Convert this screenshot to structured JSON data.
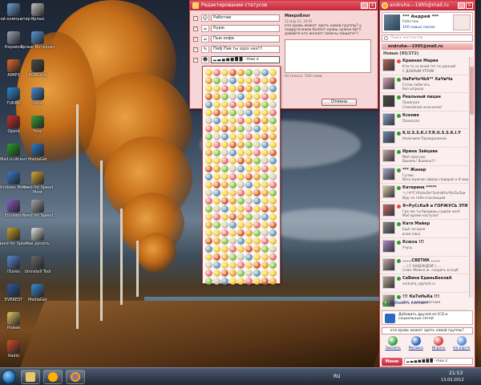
{
  "desktop": {
    "icons": [
      {
        "label": "Мой компьютер",
        "color": "#6aa0d8"
      },
      {
        "label": "Корзина",
        "color": "#9aa8b8"
      },
      {
        "label": "AIMP3",
        "color": "#e86a2a"
      },
      {
        "label": "TURBO",
        "color": "#2a8ad8"
      },
      {
        "label": "Opera",
        "color": "#d02a2a"
      },
      {
        "label": "Mail.ru Агент",
        "color": "#2aa02a"
      },
      {
        "label": "Windows Media",
        "color": "#3a78c8"
      },
      {
        "label": "Emulator",
        "color": "#8a5ac8"
      },
      {
        "label": "Need for Speed",
        "color": "#c8a02a"
      },
      {
        "label": "iTunes",
        "color": "#5a8ad8"
      },
      {
        "label": "EVEREST",
        "color": "#2a5aa8"
      },
      {
        "label": "Новые",
        "color": "#e8c86a"
      },
      {
        "label": "Radio",
        "color": "#d84a2a"
      }
    ],
    "icons_col2": [
      {
        "label": "Ярлык",
        "color": "#c8c8c8"
      },
      {
        "label": "Ярлык Интернет",
        "color": "#5a9ad8"
      },
      {
        "label": "KGBtools",
        "color": "#4a4a4a"
      },
      {
        "label": "Сеть",
        "color": "#4a8ad8"
      },
      {
        "label": "Total",
        "color": "#3aa03a"
      },
      {
        "label": "MediaGet",
        "color": "#2a7ac8"
      },
      {
        "label": "Need for Speed Most",
        "color": "#d8a83a"
      },
      {
        "label": "Need for Speed",
        "color": "#a8a8a8"
      },
      {
        "label": "Как делать",
        "color": "#e8e8e8"
      },
      {
        "label": "Uninstall Tool",
        "color": "#6a6a6a"
      },
      {
        "label": "MediaGet",
        "color": "#3a8ad8"
      }
    ]
  },
  "taskbar": {
    "lang": "RU",
    "time": "21:53",
    "date": "13.03.2012"
  },
  "status_window": {
    "title": "Редактирование статусов",
    "statuses": [
      {
        "icon": "☺",
        "text": "Работаю"
      },
      {
        "icon": "☕",
        "text": "Курю"
      },
      {
        "icon": "☕",
        "text": "Пью кофе"
      },
      {
        "icon": "✎",
        "text": "Пиф Пав ты здох нах!!!"
      },
      {
        "icon": "☻",
        "text": "▂ ▃ ▄ ▅ ▆ ▇ █ - max z"
      }
    ],
    "detail": {
      "title": "Микроблог",
      "date": "12 мар 12, 19:01",
      "text": "кто кровь может здать новой группы? у подруги мама болеет кровь нужна 4й!!! давайте кто желает помочь пишите!!!",
      "remaining": "Осталось: 500 симв."
    },
    "cancel_label": "Отмена"
  },
  "emoji_colors": [
    "#f2c94c",
    "#e8a03a",
    "#f4d24a",
    "#d85a3a",
    "#5a9ad8",
    "#f2c94c",
    "#c8c8c8",
    "#e86a8a",
    "#7ac85a"
  ],
  "agent": {
    "title": "andruha---1995@mail.ru",
    "user_name": "*** Андрей ***",
    "user_status": "Работаю",
    "user_mail": "100 новых писем",
    "search_placeholder": "Поиск контактов",
    "account": "andruha---1995@mail.ru",
    "group": "Новые (95/372)",
    "contacts": [
      {
        "name": "Кравная Мария",
        "status": "Кто-то со мной тот по данной",
        "status2": "С ДОБРЫМ УТРОМ",
        "dot": "#e84a4a",
        "avatar": "#b06a5a"
      },
      {
        "name": "НаРиЧоЧkA** ХаЧиЧа",
        "status": "Готов побегать",
        "status2": "Без шприца",
        "dot": "#2aa02a",
        "avatar": "#d8a8b8"
      },
      {
        "name": "Реальный пацан",
        "status": "Проиграл",
        "status2": "Спокойной ночи всем!",
        "dot": "#2aa02a",
        "avatar": "#4a4a4a"
      },
      {
        "name": "Ксения",
        "status": "Проиграл",
        "status2": "",
        "dot": "#2aa02a",
        "avatar": "#8aa0c8"
      },
      {
        "name": "K.U.S.S.K.I.Y.R.U.S.S.K.I.Y",
        "status": "Наличием Пражданином",
        "status2": "",
        "dot": "#2aa02a",
        "avatar": "#6a8ab0"
      },
      {
        "name": "Ирина Зайцева",
        "status": "Моё прессую",
        "status2": "Выкинь! Выкинь!!!",
        "dot": "#2aa02a",
        "avatar": "#c8a8a8"
      },
      {
        "name": "*** Жанар",
        "status": "Гуляю",
        "status2": "Всех мужчин айдаш подарок к 8 мар",
        "dot": "#2aa02a",
        "avatar": "#a8a8c8"
      },
      {
        "name": "Катерина *****",
        "status": "*=*#*СтРаНнОе*ЗнАчИтЬ*КоЛьЛаи",
        "status2": "Иду на тебя спасающий",
        "dot": "#2aa02a",
        "avatar": "#d8c8a8"
      },
      {
        "name": "Я=РуСсКаЯ и ГОРЖУСЬ ЭТИМ",
        "status": "Где же ты бродишь,судьба моя?",
        "status2": "Моё время наступит",
        "dot": "#e84a4a",
        "avatar": "#c86a6a"
      },
      {
        "name": "Катя Майер",
        "status": "Ещё сегодня",
        "status2": "всем пока",
        "dot": "#2aa02a",
        "avatar": "#8a8a8a"
      },
      {
        "name": "Ксюха !!!",
        "status": "Учусь",
        "status2": "",
        "dot": "#2aa02a",
        "avatar": "#a88ac8"
      },
      {
        "name": "......СВЕТИК ......",
        "status": "....( С НАДЕЖДОЙ ).....",
        "status2": "Снов. Можно ж. сходить в клуб",
        "dot": "#2aa02a",
        "avatar": "#c8a8a8"
      },
      {
        "name": "СаВина ЕдиньБековА",
        "status": "andruha_x@mail.ru",
        "status2": "",
        "dot": "#2aa02a",
        "avatar": "#b8a898"
      },
      {
        "name": "!!! КаТеНьКа !!!",
        "status": "Нет, я неадекватным",
        "status2": "",
        "dot": "#2aa02a",
        "avatar": "#c8b8a8"
      }
    ],
    "add_contact": "Добавить контакт",
    "promo": "Добавить друзей из ICQ и социальных сетей",
    "status_line": "кто кровь может здать новой группы?",
    "tools": [
      {
        "label": "Звонить",
        "color": "#3aa03a"
      },
      {
        "label": "Музыка",
        "color": "#2a6ac0"
      },
      {
        "label": "Играть",
        "color": "#d84a3a"
      },
      {
        "label": "На карте",
        "color": "#5a8ad8"
      }
    ],
    "menu_label": "Меню",
    "bottom_status": "▂ ▃ ▄ ▅ ▆ ▇ █ - max z"
  }
}
